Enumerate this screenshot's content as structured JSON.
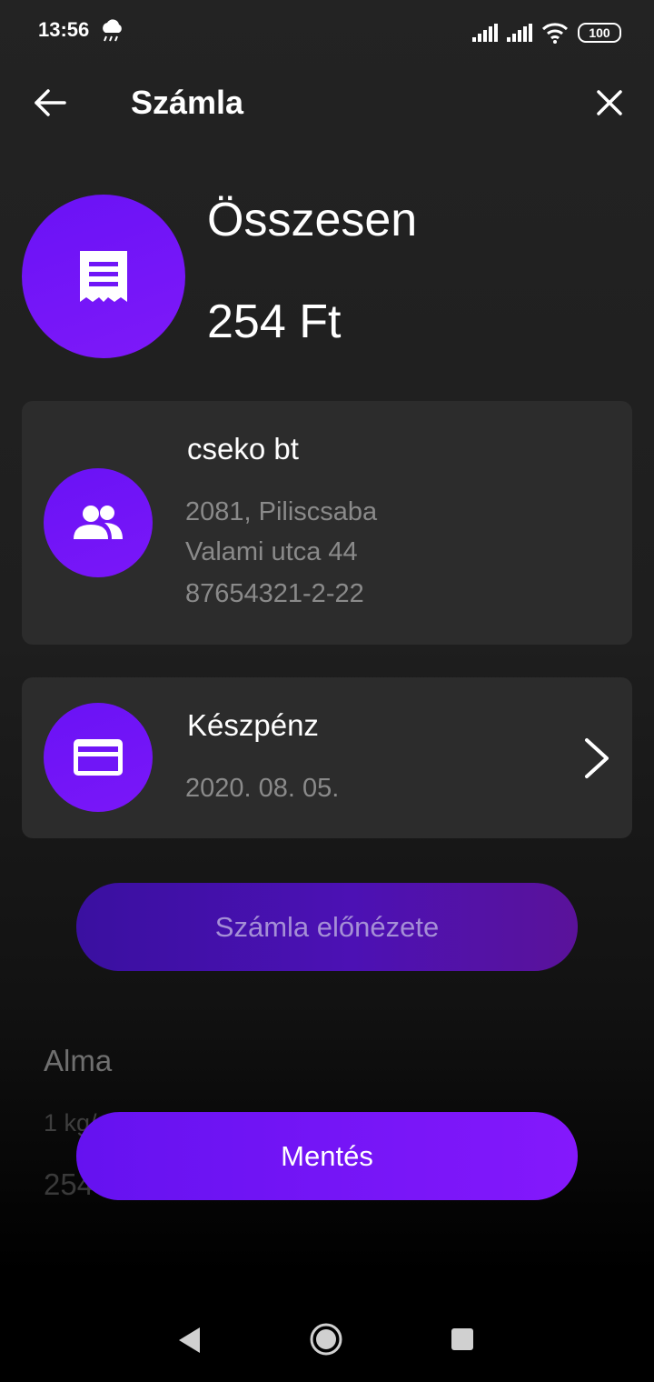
{
  "status_bar": {
    "time": "13:56",
    "battery": "100"
  },
  "header": {
    "title": "Számla"
  },
  "summary": {
    "label": "Összesen",
    "amount": "254 Ft"
  },
  "partner": {
    "name": "cseko bt",
    "address_line1": "2081, Piliscsaba",
    "address_line2": "Valami utca 44",
    "tax_number": "87654321-2-22"
  },
  "payment": {
    "method": "Készpénz",
    "date": "2020. 08. 05."
  },
  "buttons": {
    "preview": "Számla előnézete",
    "save": "Mentés"
  },
  "item": {
    "name": "Alma",
    "quantity": "1 kg/",
    "price": "254"
  },
  "colors": {
    "accent": "#7a17f8",
    "card": "#2c2c2c",
    "muted_text": "#8a8a8a"
  }
}
